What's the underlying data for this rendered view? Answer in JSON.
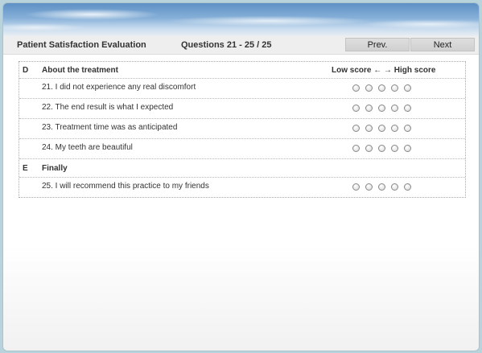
{
  "header": {
    "title": "Patient Satisfaction Evaluation",
    "question_range": "Questions 21 - 25 / 25",
    "prev_label": "Prev.",
    "next_label": "Next"
  },
  "sections": [
    {
      "letter": "D",
      "title": "About the treatment",
      "scale_label": "Low score ← → High score",
      "questions": [
        {
          "text": "21. I did not experience any real discomfort",
          "options": 5,
          "selected": null
        },
        {
          "text": "22. The end result is what I expected",
          "options": 5,
          "selected": null
        },
        {
          "text": "23. Treatment time was as anticipated",
          "options": 5,
          "selected": null
        },
        {
          "text": "24. My teeth are beautiful",
          "options": 5,
          "selected": null
        }
      ]
    },
    {
      "letter": "E",
      "title": "Finally",
      "questions": [
        {
          "text": "25. I will recommend this practice to my friends",
          "options": 5,
          "selected": null
        }
      ]
    }
  ]
}
